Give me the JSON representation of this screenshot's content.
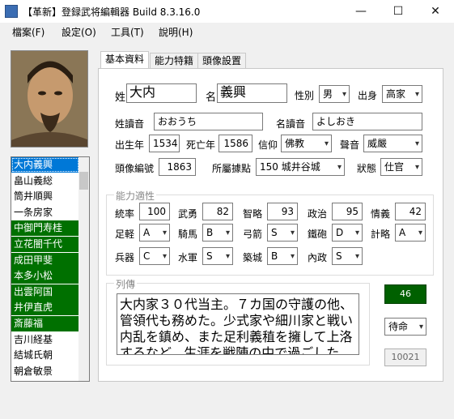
{
  "window": {
    "title": "【革新】登録武将編輯器 Build 8.3.16.0",
    "minimize": "—",
    "maximize": "☐",
    "close": "✕"
  },
  "menu": [
    "檔案(F)",
    "設定(O)",
    "工具(T)",
    "說明(H)"
  ],
  "list": {
    "items": [
      {
        "label": "大内義興",
        "state": "selected"
      },
      {
        "label": "畠山義総",
        "state": "normal"
      },
      {
        "label": "筒井順興",
        "state": "normal"
      },
      {
        "label": "一条房家",
        "state": "normal"
      },
      {
        "label": "中御門寿桂",
        "state": "green"
      },
      {
        "label": "立花闇千代",
        "state": "green"
      },
      {
        "label": "成田甲斐",
        "state": "green"
      },
      {
        "label": "本多小松",
        "state": "green"
      },
      {
        "label": "出雲阿国",
        "state": "green"
      },
      {
        "label": "井伊直虎",
        "state": "green"
      },
      {
        "label": "斎藤福",
        "state": "green"
      },
      {
        "label": "吉川経基",
        "state": "normal"
      },
      {
        "label": "結城氏朝",
        "state": "normal"
      },
      {
        "label": "朝倉敏景",
        "state": "normal"
      }
    ]
  },
  "tabs": [
    "基本資料",
    "能力特籍",
    "頭像設置"
  ],
  "basic": {
    "surname_label": "姓",
    "surname": "大内",
    "given_label": "名",
    "given": "義興",
    "gender_label": "性別",
    "gender": "男",
    "origin_label": "出身",
    "origin": "高家",
    "surname_reading_label": "姓讀音",
    "surname_reading": "おおうち",
    "given_reading_label": "名讀音",
    "given_reading": "よしおき",
    "birth_label": "出生年",
    "birth": "1534",
    "death_label": "死亡年",
    "death": "1586",
    "faith_label": "信仰",
    "faith": "佛教",
    "voice_label": "聲音",
    "voice": "威嚴",
    "portrait_no_label": "頭像編號",
    "portrait_no": "1863",
    "location_label": "所屬據點",
    "location": "150 城井谷城",
    "status_label": "狀態",
    "status": "仕官"
  },
  "ability": {
    "title": "能力適性",
    "stats": [
      {
        "label": "統率",
        "value": "100"
      },
      {
        "label": "武勇",
        "value": "82"
      },
      {
        "label": "智略",
        "value": "93"
      },
      {
        "label": "政治",
        "value": "95"
      },
      {
        "label": "情義",
        "value": "42"
      }
    ],
    "apt_row1": [
      {
        "label": "足軽",
        "value": "A"
      },
      {
        "label": "騎馬",
        "value": "B"
      },
      {
        "label": "弓箭",
        "value": "S"
      },
      {
        "label": "鐵砲",
        "value": "D"
      },
      {
        "label": "計略",
        "value": "A"
      }
    ],
    "apt_row2": [
      {
        "label": "兵器",
        "value": "C"
      },
      {
        "label": "水軍",
        "value": "S"
      },
      {
        "label": "築城",
        "value": "B"
      },
      {
        "label": "內政",
        "value": "S"
      }
    ]
  },
  "bio": {
    "title": "列傳",
    "text": "大内家３０代当主。７カ国の守護の他、管領代も務めた。少式家や細川家と戦い内乱を鎮め、また足利義稙を擁して上洛するなど、生涯を戦陣の中で過ごした。"
  },
  "side": {
    "green_value": "46",
    "mode": "待命",
    "id": "10021"
  }
}
